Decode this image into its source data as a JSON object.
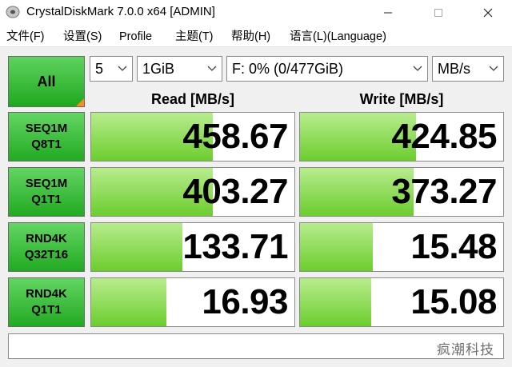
{
  "window": {
    "title": "CrystalDiskMark 7.0.0 x64 [ADMIN]"
  },
  "menu": {
    "items": [
      "文件(F)",
      "设置(S)",
      "Profile",
      "主题(T)",
      "帮助(H)",
      "语言(L)(Language)"
    ]
  },
  "controls": {
    "all_label": "All",
    "count": "5",
    "size": "1GiB",
    "drive": "F: 0% (0/477GiB)",
    "unit": "MB/s"
  },
  "headers": {
    "read": "Read [MB/s]",
    "write": "Write [MB/s]"
  },
  "tests": [
    {
      "line1": "SEQ1M",
      "line2": "Q8T1",
      "read": "458.67",
      "write": "424.85",
      "read_fill": 0.6,
      "write_fill": 0.57
    },
    {
      "line1": "SEQ1M",
      "line2": "Q1T1",
      "read": "403.27",
      "write": "373.27",
      "read_fill": 0.6,
      "write_fill": 0.56
    },
    {
      "line1": "RND4K",
      "line2": "Q32T16",
      "read": "133.71",
      "write": "15.48",
      "read_fill": 0.45,
      "write_fill": 0.36
    },
    {
      "line1": "RND4K",
      "line2": "Q1T1",
      "read": "16.93",
      "write": "15.08",
      "read_fill": 0.37,
      "write_fill": 0.35
    }
  ],
  "comment": "",
  "watermark": "疯潮科技",
  "colors": {
    "button_green": "#22aa22",
    "bar_green": "#6ccd2e",
    "corner_orange": "#ff8c1a"
  }
}
